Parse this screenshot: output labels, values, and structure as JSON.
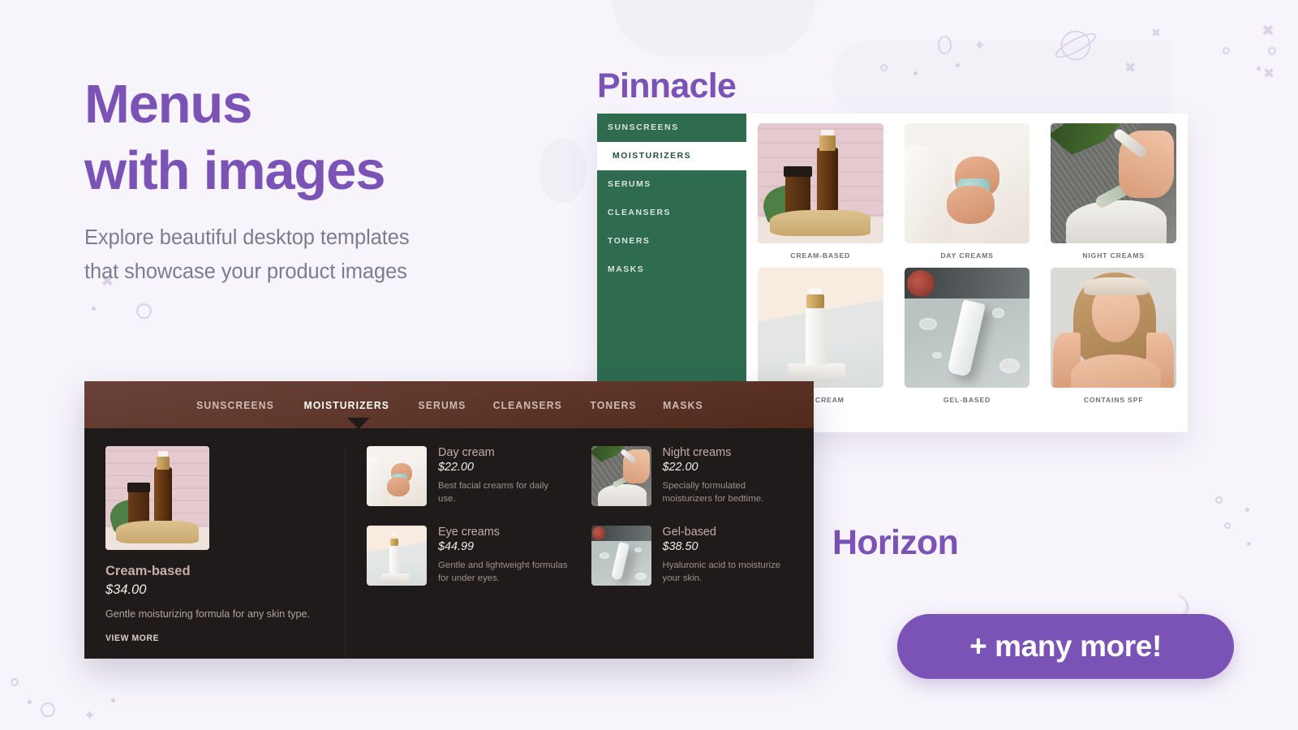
{
  "hero": {
    "title_line1": "Menus",
    "title_line2": "with images",
    "subtitle_line1": "Explore beautiful desktop templates",
    "subtitle_line2": "that showcase your product images"
  },
  "colors": {
    "accent_purple": "#7b52b5",
    "page_background": "#f7f5fb",
    "pinnacle_green": "#2f6b4f",
    "horizon_dark": "#1e1b1a",
    "horizon_nav_brown": "#5d3529",
    "horizon_title_rose": "#c5aea6"
  },
  "pinnacle": {
    "label": "Pinnacle",
    "sidebar": {
      "items": [
        {
          "label": "SUNSCREENS",
          "active": false
        },
        {
          "label": "MOISTURIZERS",
          "active": true
        },
        {
          "label": "SERUMS",
          "active": false
        },
        {
          "label": "CLEANSERS",
          "active": false
        },
        {
          "label": "TONERS",
          "active": false
        },
        {
          "label": "MASKS",
          "active": false
        }
      ]
    },
    "grid": [
      {
        "caption": "CREAM-BASED",
        "art": "ph-cream"
      },
      {
        "caption": "DAY CREAMS",
        "art": "ph-day"
      },
      {
        "caption": "NIGHT CREAMS",
        "art": "ph-night"
      },
      {
        "caption": "EYE CREAM",
        "art": "ph-eye"
      },
      {
        "caption": "GEL-BASED",
        "art": "ph-gel"
      },
      {
        "caption": "CONTAINS SPF",
        "art": "ph-spf"
      }
    ]
  },
  "horizon": {
    "label": "Horizon",
    "nav": {
      "tabs": [
        {
          "label": "SUNSCREENS",
          "active": false
        },
        {
          "label": "MOISTURIZERS",
          "active": true
        },
        {
          "label": "SERUMS",
          "active": false
        },
        {
          "label": "CLEANSERS",
          "active": false
        },
        {
          "label": "TONERS",
          "active": false
        },
        {
          "label": "MASKS",
          "active": false
        }
      ]
    },
    "feature": {
      "title": "Cream-based",
      "price": "$34.00",
      "description": "Gentle moisturizing formula for any skin type.",
      "view_more_label": "VIEW MORE",
      "art": "ph-cream"
    },
    "items": [
      {
        "title": "Day cream",
        "price": "$22.00",
        "description": "Best facial creams for daily use.",
        "art": "ph-day"
      },
      {
        "title": "Night creams",
        "price": "$22.00",
        "description": "Specially formulated moisturizers for bedtime.",
        "art": "ph-night"
      },
      {
        "title": "Eye creams",
        "price": "$44.99",
        "description": "Gentle and lightweight formulas for under eyes.",
        "art": "ph-eye"
      },
      {
        "title": "Gel-based",
        "price": "$38.50",
        "description": "Hyaluronic acid to moisturize your skin.",
        "art": "ph-gel"
      }
    ]
  },
  "cta": {
    "label": "+ many more!"
  },
  "decor": {
    "planet_icon": "saturn-planet-icon",
    "moon_icon": "crescent-moon-icon",
    "sparkle_icon": "four-point-star-icon"
  }
}
